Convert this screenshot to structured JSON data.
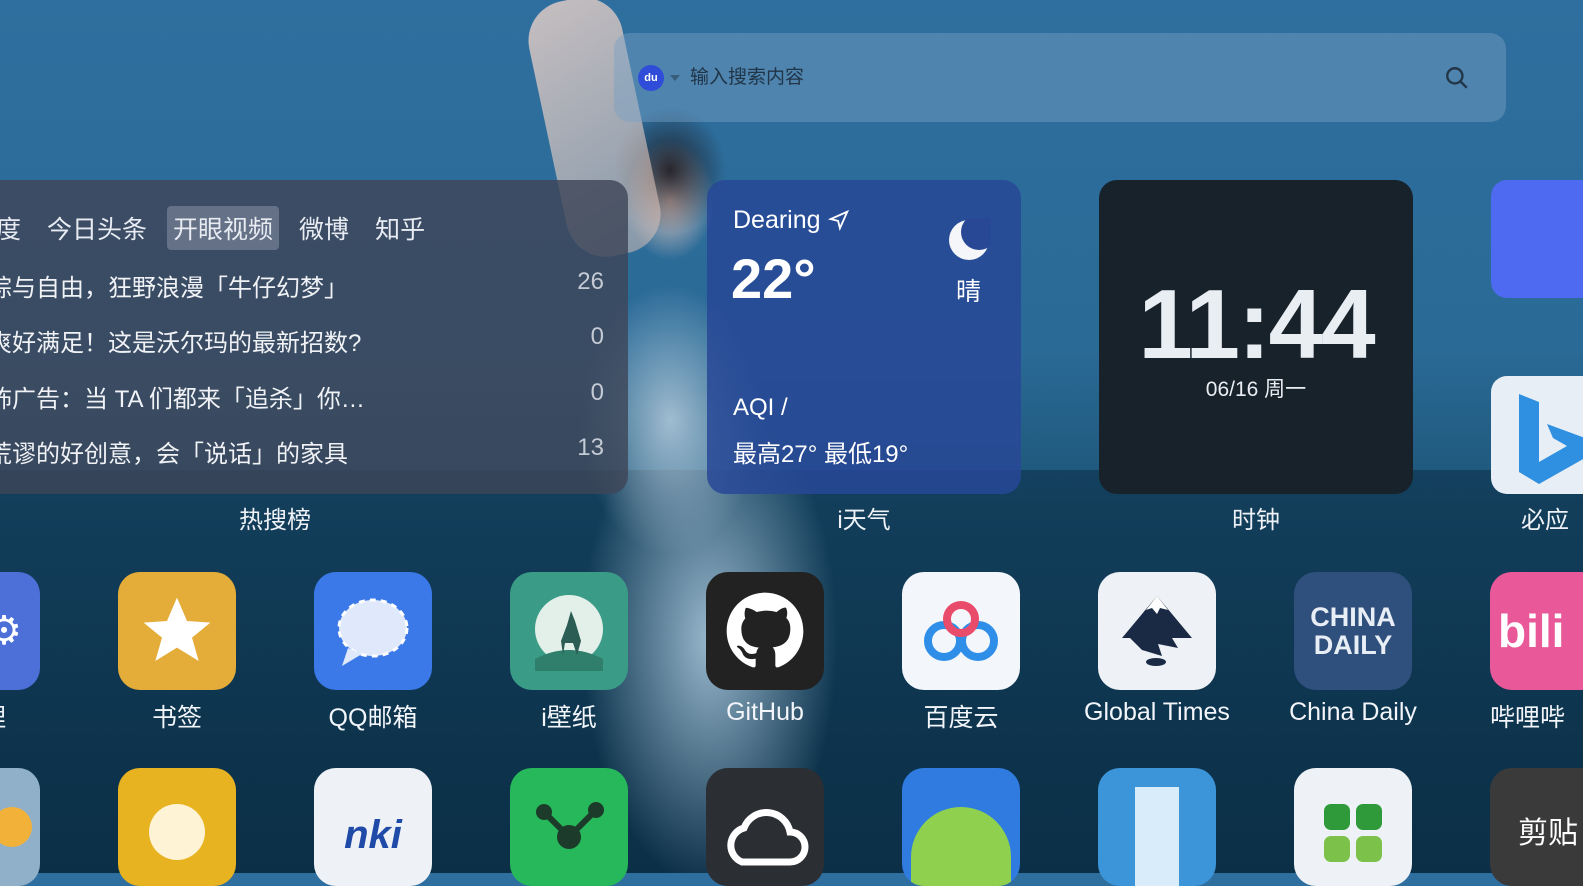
{
  "search": {
    "placeholder": "输入搜索内容",
    "engine_icon_text": "du"
  },
  "hot_list": {
    "tabs": [
      "度",
      "今日头条",
      "开眼视频",
      "微博",
      "知乎"
    ],
    "active_tab": "开眼视频",
    "items": [
      {
        "title": "粽与自由，狂野浪漫「牛仔幻梦」",
        "count": "26"
      },
      {
        "title": "爽好满足！这是沃尔玛的最新招数?",
        "count": "0"
      },
      {
        "title": "怖广告：当 TA 们都来「追杀」你…",
        "count": "0"
      },
      {
        "title": "荒谬的好创意，会「说话」的家具",
        "count": "13"
      }
    ],
    "label": "热搜榜"
  },
  "weather": {
    "city": "Dearing",
    "temp": "22°",
    "condition": "晴",
    "aqi": "AQI /",
    "range": "最高27° 最低19°",
    "label": "i天气",
    "bg_color": "#284896"
  },
  "clock": {
    "time": "11:44",
    "date": "06/16 周一",
    "label": "时钟"
  },
  "right_tiles": {
    "bing_label": "必应"
  },
  "apps_row1": [
    {
      "label": "管理",
      "icon": "manage-icon",
      "color": "#4c6fd8"
    },
    {
      "label": "书签",
      "icon": "star-icon",
      "color": "#e4ad3a"
    },
    {
      "label": "QQ邮箱",
      "icon": "chat-bubble-icon",
      "color": "#3b78e8"
    },
    {
      "label": "i壁纸",
      "icon": "deer-moon-icon",
      "color": "#3a9c86"
    },
    {
      "label": "GitHub",
      "icon": "github-icon",
      "color": "#222222"
    },
    {
      "label": "百度云",
      "icon": "baidu-cloud-icon",
      "color": "#f3f6fa"
    },
    {
      "label": "Global Times",
      "icon": "inkscape-icon",
      "color": "#eef2f6"
    },
    {
      "label": "China Daily",
      "icon": "china-daily-icon",
      "color": "#2f4f7c"
    },
    {
      "label": "哔哩哔",
      "icon": "bilibili-icon",
      "color": "#e9599a"
    }
  ],
  "china_daily_logo": [
    "CHINA",
    "DAILY"
  ],
  "cnki_logo": "nki",
  "jiantie_text": "剪贴",
  "apps_row2": [
    {
      "icon": "sun-icon",
      "color": "#8fb0c8"
    },
    {
      "icon": "lightbulb-icon",
      "color": "#e7b321"
    },
    {
      "icon": "cnki-icon",
      "color": "#eef2f7"
    },
    {
      "icon": "network-icon",
      "color": "#26b85a"
    },
    {
      "icon": "cloud-outline-icon",
      "color": "#2b2e33"
    },
    {
      "icon": "android-icon",
      "color": "#2f7be0"
    },
    {
      "icon": "bookmark-ribbon-icon",
      "color": "#3b95d8"
    },
    {
      "icon": "clover-icon",
      "color": "#eef2f6"
    },
    {
      "icon": "clipboard-icon",
      "color": "#3a3a3a"
    }
  ]
}
